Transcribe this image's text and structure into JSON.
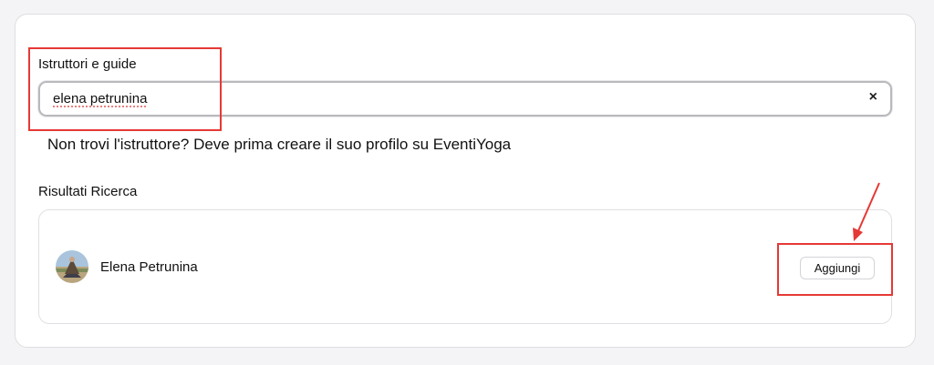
{
  "instructors_field": {
    "label": "Istruttori e guide",
    "value": "elena petrunina",
    "clear_symbol": "×"
  },
  "hint_text": "Non trovi l'istruttore? Deve prima creare il suo profilo su EventiYoga",
  "results": {
    "heading": "Risultati Ricerca",
    "items": [
      {
        "name": "Elena Petrunina",
        "action_label": "Aggiungi"
      }
    ]
  },
  "annotations": {
    "color": "#e53935"
  }
}
